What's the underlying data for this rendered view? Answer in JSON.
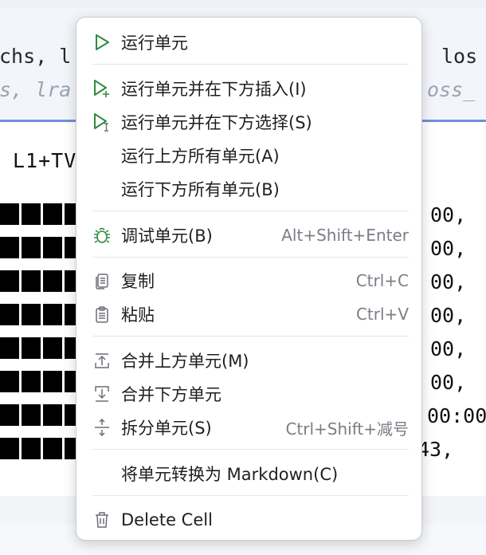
{
  "background": {
    "code_line1_left": "chs, l",
    "code_line2_left": "s, lra",
    "code_line1_right": "los",
    "code_line2_right": "oss_",
    "output_label": "L1+TV",
    "output_right_values": [
      "00,",
      "00,",
      "00,",
      "00,",
      "00,",
      "00,",
      "00:00",
      "43,"
    ]
  },
  "menu": {
    "items": [
      {
        "label": "运行单元",
        "shortcut": "",
        "icon": "run-icon"
      },
      {
        "label": "运行单元并在下方插入(I)",
        "shortcut": "",
        "icon": "run-insert-below-icon"
      },
      {
        "label": "运行单元并在下方选择(S)",
        "shortcut": "",
        "icon": "run-select-below-icon"
      },
      {
        "label": "运行上方所有单元(A)",
        "shortcut": "",
        "icon": ""
      },
      {
        "label": "运行下方所有单元(B)",
        "shortcut": "",
        "icon": ""
      },
      {
        "label": "调试单元(B)",
        "shortcut": "Alt+Shift+Enter",
        "icon": "debug-icon"
      },
      {
        "label": "复制",
        "shortcut": "Ctrl+C",
        "icon": "copy-icon"
      },
      {
        "label": "粘贴",
        "shortcut": "Ctrl+V",
        "icon": "paste-icon"
      },
      {
        "label": "合并上方单元(M)",
        "shortcut": "",
        "icon": "merge-above-icon"
      },
      {
        "label": "合并下方单元",
        "shortcut": "",
        "icon": "merge-below-icon"
      },
      {
        "label": "拆分单元(S)",
        "shortcut": "Ctrl+Shift+减号",
        "icon": "split-icon"
      },
      {
        "label": "将单元转换为 Markdown(C)",
        "shortcut": "",
        "icon": ""
      },
      {
        "label": "Delete Cell",
        "shortcut": "",
        "icon": "trash-icon"
      }
    ]
  },
  "colors": {
    "run_green": "#2e8b3e",
    "icon_gray": "#6b6f76"
  }
}
